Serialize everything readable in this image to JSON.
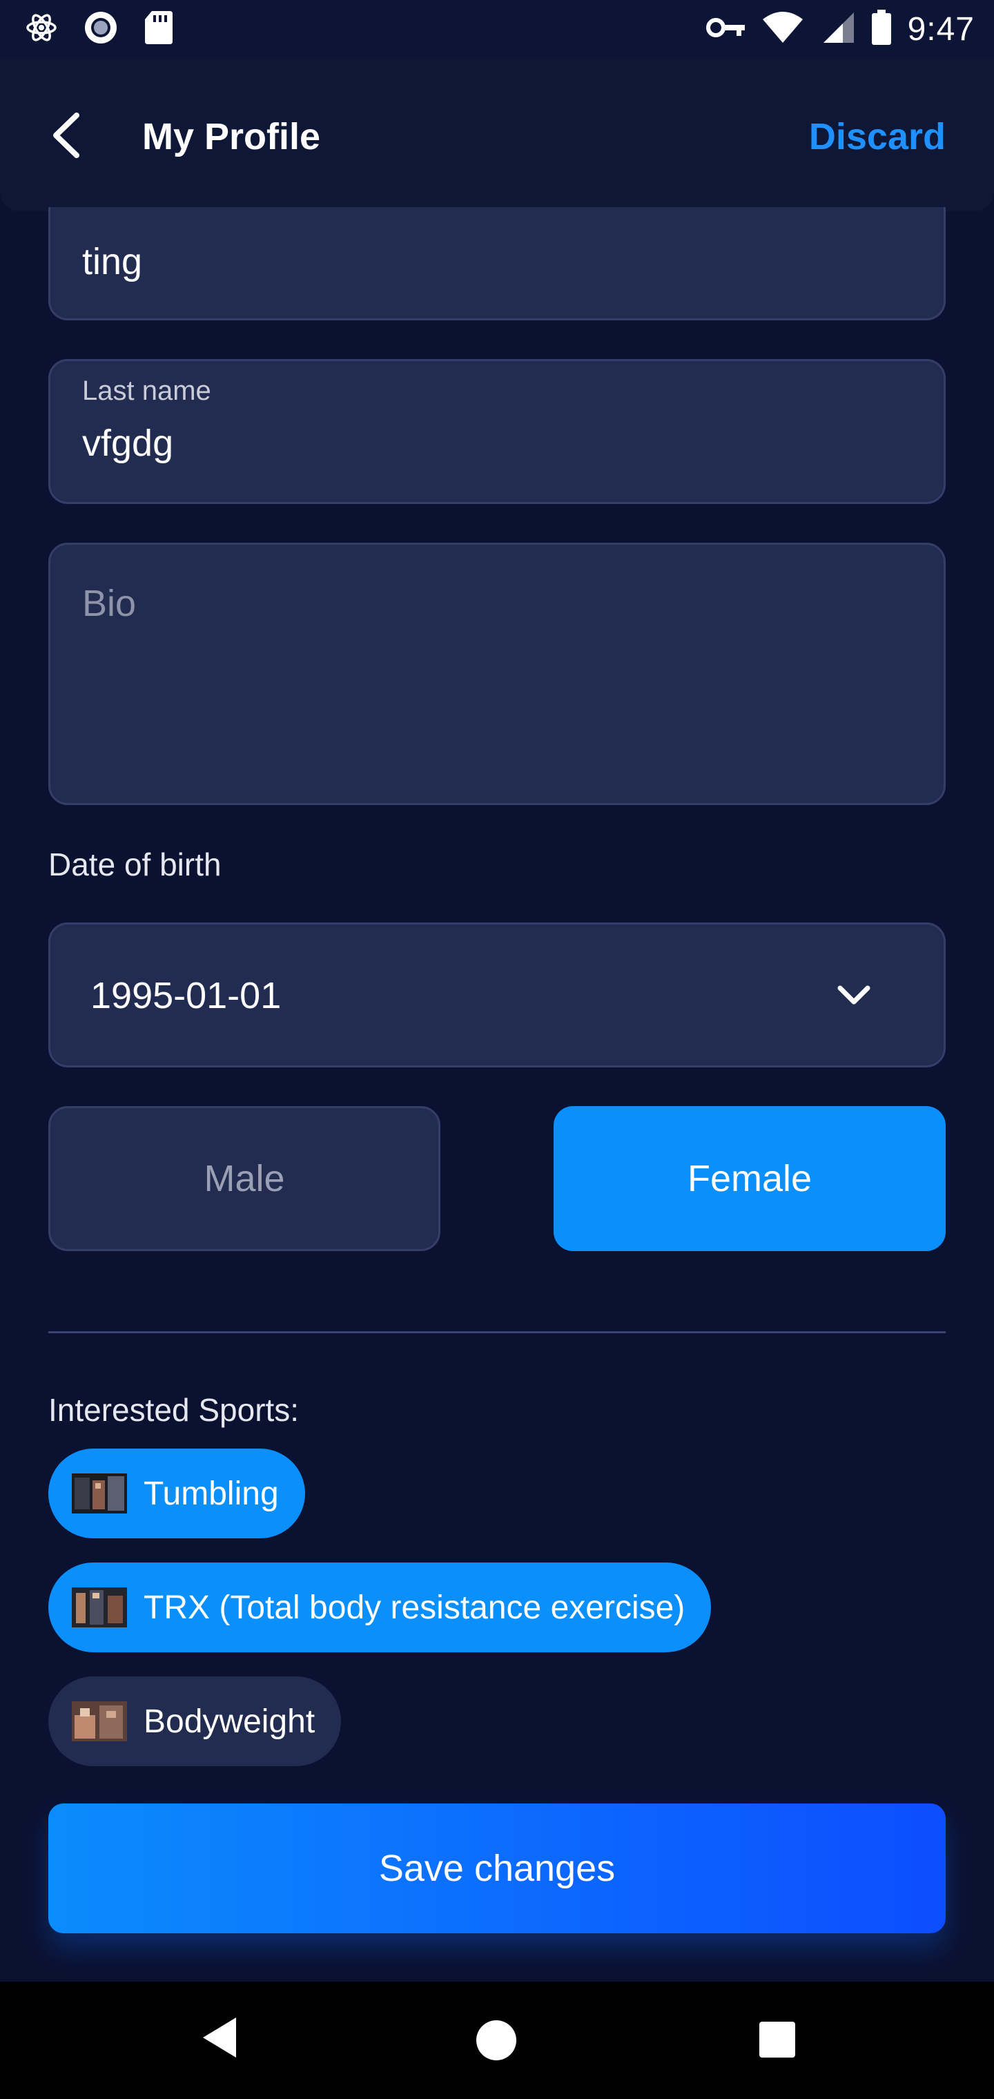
{
  "status_bar": {
    "time": "9:47",
    "icons": [
      "atom-icon",
      "circle-dot-icon",
      "sd-card-icon",
      "key-icon",
      "wifi-icon",
      "signal-icon",
      "battery-icon"
    ]
  },
  "header": {
    "title": "My Profile",
    "discard_label": "Discard",
    "back_icon": "chevron-left-icon"
  },
  "form": {
    "first_name_value": "ting",
    "last_name_label": "Last name",
    "last_name_value": "vfgdg",
    "bio_placeholder": "Bio",
    "dob_label": "Date of birth",
    "dob_value": "1995-01-01",
    "gender": {
      "male_label": "Male",
      "female_label": "Female",
      "selected": "Female"
    }
  },
  "sports": {
    "label": "Interested Sports:",
    "items": [
      {
        "label": "Tumbling",
        "selected": true
      },
      {
        "label": "TRX (Total body resistance exercise)",
        "selected": true
      },
      {
        "label": "Bodyweight",
        "selected": false
      }
    ]
  },
  "save_label": "Save changes",
  "colors": {
    "background": "#0b1130",
    "field": "#222b50",
    "accent": "#0a8ffb",
    "accent_text": "#1e90ff"
  }
}
